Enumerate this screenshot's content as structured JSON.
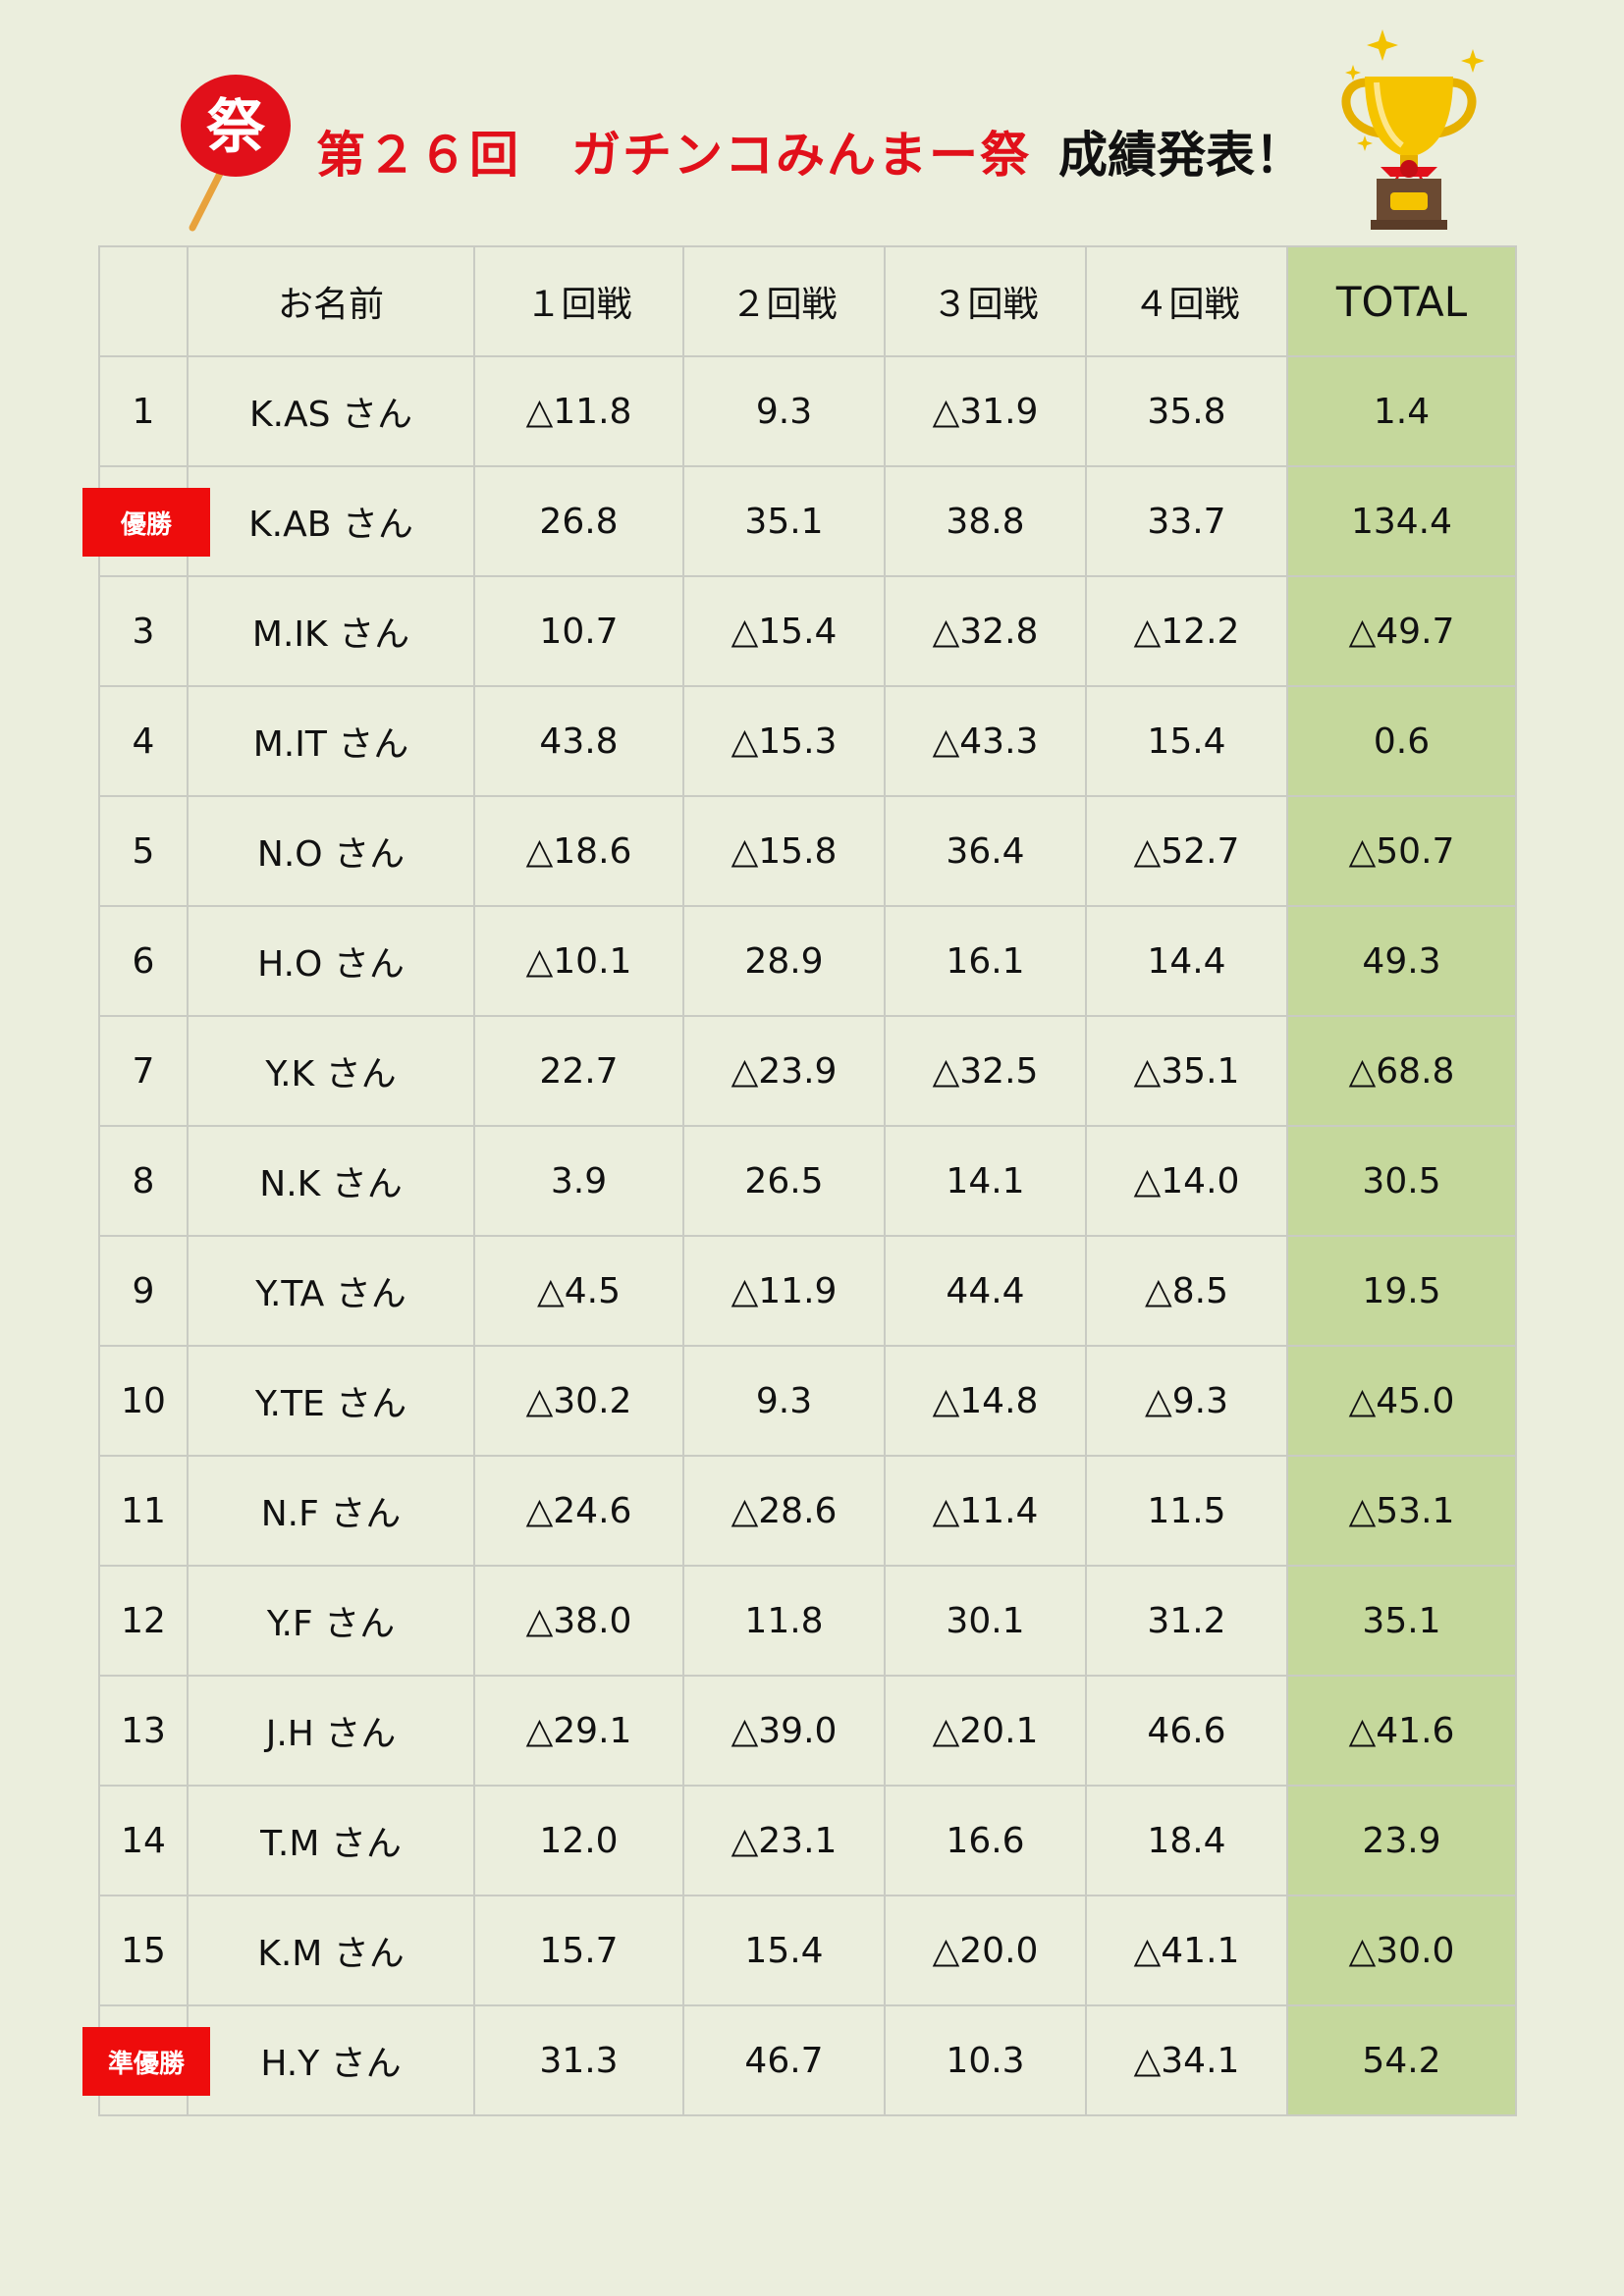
{
  "header": {
    "fan_char": "祭",
    "title_red": "第２６回　ガチンコみんまー祭",
    "title_black": "成績発表！"
  },
  "table": {
    "headers": [
      "",
      "お名前",
      "１回戦",
      "２回戦",
      "３回戦",
      "４回戦",
      "TOTAL"
    ],
    "rows": [
      {
        "rank": "1",
        "badge": "",
        "name": "K.AS さん",
        "r1": "△11.8",
        "r2": "9.3",
        "r3": "△31.9",
        "r4": "35.8",
        "total": "1.4"
      },
      {
        "rank": "",
        "badge": "優勝",
        "name": "K.AB さん",
        "r1": "26.8",
        "r2": "35.1",
        "r3": "38.8",
        "r4": "33.7",
        "total": "134.4"
      },
      {
        "rank": "3",
        "badge": "",
        "name": "M.IK さん",
        "r1": "10.7",
        "r2": "△15.4",
        "r3": "△32.8",
        "r4": "△12.2",
        "total": "△49.7"
      },
      {
        "rank": "4",
        "badge": "",
        "name": "M.IT さん",
        "r1": "43.8",
        "r2": "△15.3",
        "r3": "△43.3",
        "r4": "15.4",
        "total": "0.6"
      },
      {
        "rank": "5",
        "badge": "",
        "name": "N.O さん",
        "r1": "△18.6",
        "r2": "△15.8",
        "r3": "36.4",
        "r4": "△52.7",
        "total": "△50.7"
      },
      {
        "rank": "6",
        "badge": "",
        "name": "H.O さん",
        "r1": "△10.1",
        "r2": "28.9",
        "r3": "16.1",
        "r4": "14.4",
        "total": "49.3"
      },
      {
        "rank": "7",
        "badge": "",
        "name": "Y.K さん",
        "r1": "22.7",
        "r2": "△23.9",
        "r3": "△32.5",
        "r4": "△35.1",
        "total": "△68.8"
      },
      {
        "rank": "8",
        "badge": "",
        "name": "N.K さん",
        "r1": "3.9",
        "r2": "26.5",
        "r3": "14.1",
        "r4": "△14.0",
        "total": "30.5"
      },
      {
        "rank": "9",
        "badge": "",
        "name": "Y.TA さん",
        "r1": "△4.5",
        "r2": "△11.9",
        "r3": "44.4",
        "r4": "△8.5",
        "total": "19.5"
      },
      {
        "rank": "10",
        "badge": "",
        "name": "Y.TE さん",
        "r1": "△30.2",
        "r2": "9.3",
        "r3": "△14.8",
        "r4": "△9.3",
        "total": "△45.0"
      },
      {
        "rank": "11",
        "badge": "",
        "name": "N.F さん",
        "r1": "△24.6",
        "r2": "△28.6",
        "r3": "△11.4",
        "r4": "11.5",
        "total": "△53.1"
      },
      {
        "rank": "12",
        "badge": "",
        "name": "Y.F さん",
        "r1": "△38.0",
        "r2": "11.8",
        "r3": "30.1",
        "r4": "31.2",
        "total": "35.1"
      },
      {
        "rank": "13",
        "badge": "",
        "name": "J.H さん",
        "r1": "△29.1",
        "r2": "△39.0",
        "r3": "△20.1",
        "r4": "46.6",
        "total": "△41.6"
      },
      {
        "rank": "14",
        "badge": "",
        "name": "T.M さん",
        "r1": "12.0",
        "r2": "△23.1",
        "r3": "16.6",
        "r4": "18.4",
        "total": "23.9"
      },
      {
        "rank": "15",
        "badge": "",
        "name": "K.M さん",
        "r1": "15.7",
        "r2": "15.4",
        "r3": "△20.0",
        "r4": "△41.1",
        "total": "△30.0"
      },
      {
        "rank": "",
        "badge": "準優勝",
        "name": "H.Y さん",
        "r1": "31.3",
        "r2": "46.7",
        "r3": "10.3",
        "r4": "△34.1",
        "total": "54.2"
      }
    ]
  },
  "colors": {
    "background": "#ebeedd",
    "negative_text": "#e1101a",
    "total_column": "#c5d89c",
    "badge": "#ee0c0c"
  }
}
